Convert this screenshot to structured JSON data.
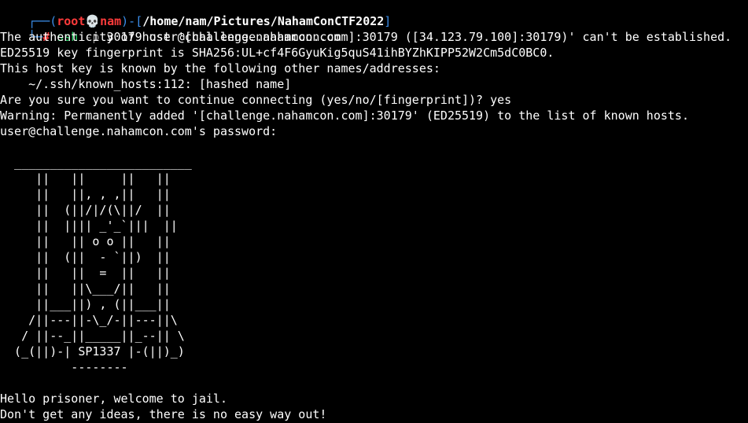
{
  "prompt": {
    "box_top_left": "┌──(",
    "user": "root",
    "skull": "💀",
    "host": "nam",
    "sep": ")-[",
    "cwd": "/home/nam/Pictures/NahamConCTF2022",
    "close": "]",
    "box_bottom_left": "└─",
    "hash": "#",
    "cmd": "ssh",
    "flag": "-p",
    "args": "30179 user@challenge.nahamcon.com"
  },
  "output_lines": [
    "The authenticity of host '[challenge.nahamcon.com]:30179 ([34.123.79.100]:30179)' can't be established.",
    "ED25519 key fingerprint is SHA256:UL+cf4F6GyuKig5quS41ihBYZhKIPP52W2Cm5dC0BC0.",
    "This host key is known by the following other names/addresses:",
    "    ~/.ssh/known_hosts:112: [hashed name]",
    "Are you sure you want to continue connecting (yes/no/[fingerprint])? yes",
    "Warning: Permanently added '[challenge.nahamcon.com]:30179' (ED25519) to the list of known hosts.",
    "user@challenge.nahamcon.com's password: "
  ],
  "ascii_art": [
    "  _________________________",
    "     ||   ||     ||   ||",
    "     ||   ||, , ,||   ||",
    "     ||  (||/|/(\\||/  ||",
    "     ||  |||| _'_`|||  ||",
    "     ||   || o o ||   ||",
    "     ||  (||  - `||)  ||",
    "     ||   ||  =  ||   ||",
    "     ||   ||\\___/||   ||",
    "     ||___||) , (||___||",
    "    /||---||-\\_/-||---||\\",
    "   / ||--_||_____||_--|| \\",
    "  (_(||)-| SP1337 |-(||)_)",
    "          --------"
  ],
  "welcome_lines": [
    "Hello prisoner, welcome to jail.",
    "Don't get any ideas, there is no easy way out!"
  ],
  "colors": {
    "background": "#000000",
    "prompt_frame": "#3b8eea",
    "prompt_user": "#ff3b3b",
    "command": "#20d060",
    "text": "#ffffff"
  }
}
